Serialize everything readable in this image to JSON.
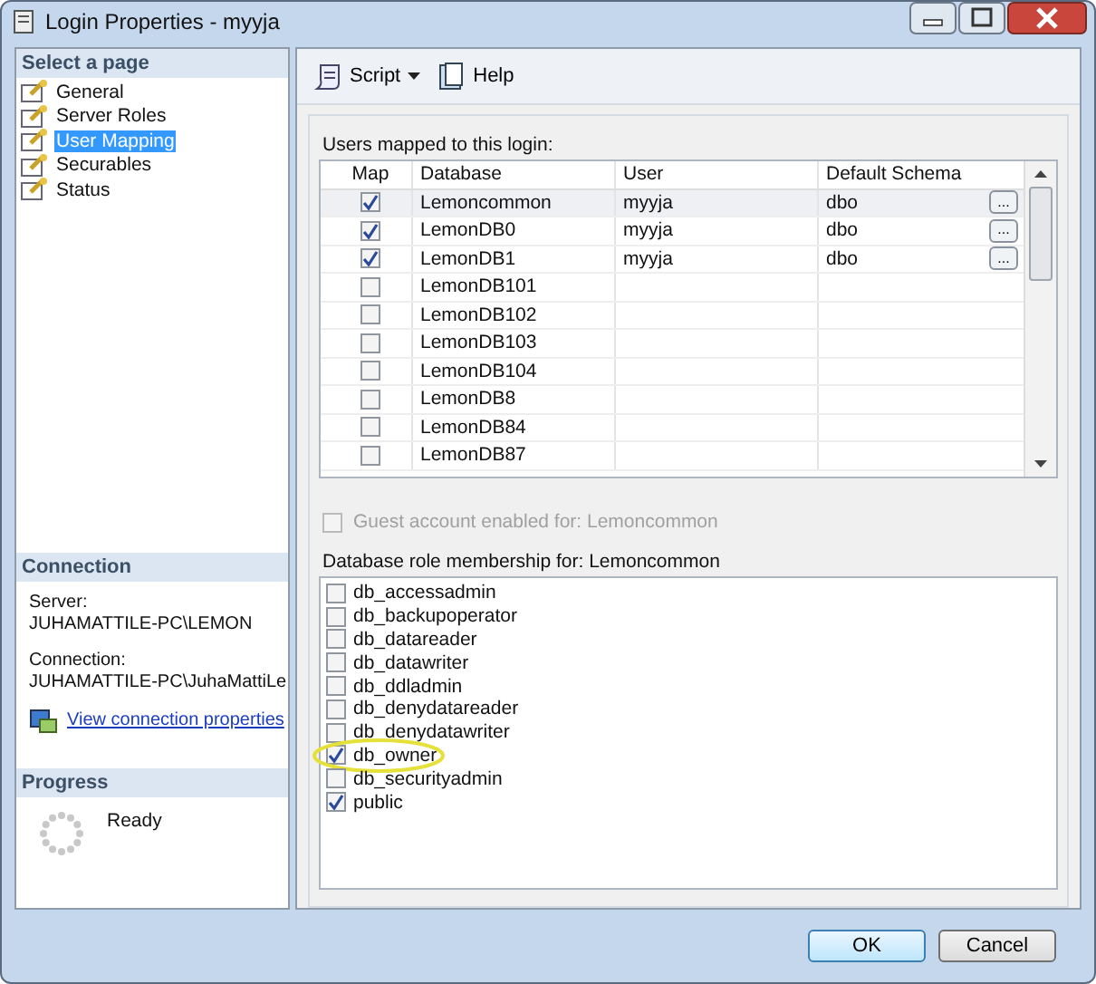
{
  "window": {
    "title": "Login Properties - myyja"
  },
  "sidebar": {
    "header": "Select a page",
    "items": [
      {
        "label": "General",
        "selected": false
      },
      {
        "label": "Server Roles",
        "selected": false
      },
      {
        "label": "User Mapping",
        "selected": true
      },
      {
        "label": "Securables",
        "selected": false
      },
      {
        "label": "Status",
        "selected": false
      }
    ]
  },
  "connection": {
    "header": "Connection",
    "server_label": "Server:",
    "server": "JUHAMATTILE-PC\\LEMON",
    "connection_label": "Connection:",
    "connection": "JUHAMATTILE-PC\\JuhaMattiLe",
    "link": "View connection properties"
  },
  "progress": {
    "header": "Progress",
    "status": "Ready"
  },
  "toolbar": {
    "script": "Script",
    "help": "Help"
  },
  "users_table": {
    "label": "Users mapped to this login:",
    "columns": [
      "Map",
      "Database",
      "User",
      "Default Schema"
    ],
    "rows": [
      {
        "map": true,
        "database": "Lemoncommon",
        "user": "myyja",
        "schema": "dbo",
        "button": "...",
        "selected": true
      },
      {
        "map": true,
        "database": "LemonDB0",
        "user": "myyja",
        "schema": "dbo",
        "button": "...",
        "selected": false
      },
      {
        "map": true,
        "database": "LemonDB1",
        "user": "myyja",
        "schema": "dbo",
        "button": "...",
        "selected": false
      },
      {
        "map": false,
        "database": "LemonDB101",
        "selected": false
      },
      {
        "map": false,
        "database": "LemonDB102",
        "selected": false
      },
      {
        "map": false,
        "database": "LemonDB103",
        "selected": false
      },
      {
        "map": false,
        "database": "LemonDB104",
        "selected": false
      },
      {
        "map": false,
        "database": "LemonDB8",
        "selected": false
      },
      {
        "map": false,
        "database": "LemonDB84",
        "selected": false
      },
      {
        "map": false,
        "database": "LemonDB87",
        "selected": false
      }
    ]
  },
  "guest": {
    "label": "Guest account enabled for: Lemoncommon",
    "checked": false,
    "disabled": true
  },
  "roles": {
    "label": "Database role membership for: Lemoncommon",
    "items": [
      {
        "label": "db_accessadmin",
        "checked": false,
        "highlighted": false
      },
      {
        "label": "db_backupoperator",
        "checked": false,
        "highlighted": false
      },
      {
        "label": "db_datareader",
        "checked": false,
        "highlighted": false
      },
      {
        "label": "db_datawriter",
        "checked": false,
        "highlighted": false
      },
      {
        "label": "db_ddladmin",
        "checked": false,
        "highlighted": false
      },
      {
        "label": "db_denydatareader",
        "checked": false,
        "highlighted": false
      },
      {
        "label": "db_denydatawriter",
        "checked": false,
        "highlighted": false
      },
      {
        "label": "db_owner",
        "checked": true,
        "highlighted": true
      },
      {
        "label": "db_securityadmin",
        "checked": false,
        "highlighted": false
      },
      {
        "label": "public",
        "checked": true,
        "highlighted": false
      }
    ]
  },
  "buttons": [
    "OK",
    "Cancel"
  ]
}
